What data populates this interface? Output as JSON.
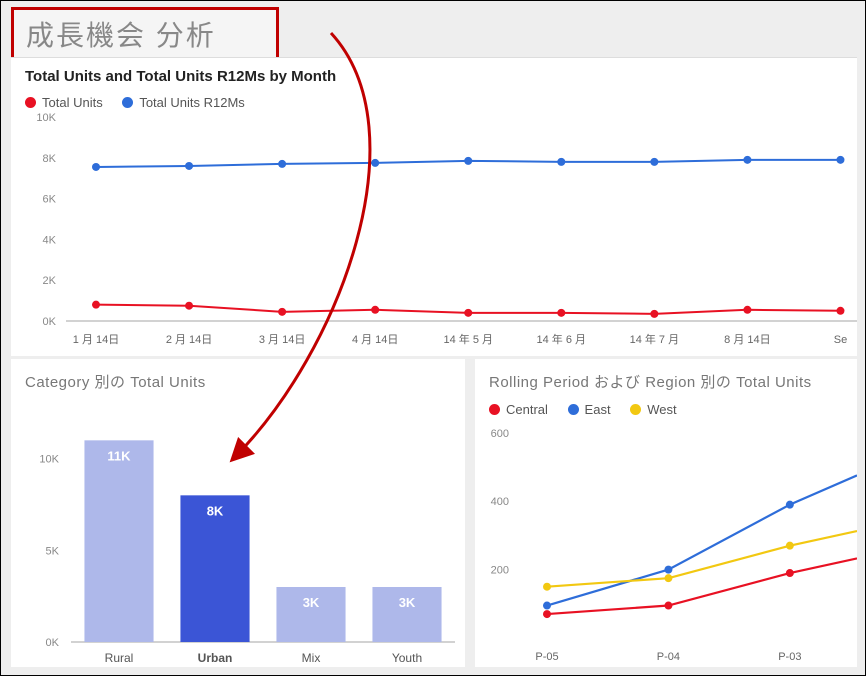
{
  "header": {
    "title": "成長機会 分析"
  },
  "chart_data": [
    {
      "id": "top",
      "type": "line",
      "title": "Total Units and Total Units R12Ms by Month",
      "xlabel": "",
      "ylabel": "",
      "yticks": [
        "0K",
        "2K",
        "4K",
        "6K",
        "8K",
        "10K"
      ],
      "ylim": [
        0,
        10
      ],
      "categories": [
        "1 月 14日",
        "2 月 14日",
        "3 月 14日",
        "4 月 14日",
        "14 年 5 月",
        "14 年 6 月",
        "14 年 7 月",
        "8 月 14日",
        "Se"
      ],
      "series": [
        {
          "name": "Total Units",
          "color": "#e81123",
          "values": [
            0.8,
            0.75,
            0.45,
            0.55,
            0.4,
            0.4,
            0.35,
            0.55,
            0.5
          ]
        },
        {
          "name": "Total Units R12Ms",
          "color": "#2e6dd9",
          "values": [
            7.55,
            7.6,
            7.7,
            7.75,
            7.85,
            7.8,
            7.8,
            7.9,
            7.9
          ]
        }
      ],
      "annotation_highlight_index": 2,
      "annotation_highlight_color": "#c00000"
    },
    {
      "id": "bottom-left",
      "type": "bar",
      "title": "Category 別の Total Units",
      "yticks": [
        "0K",
        "5K",
        "10K"
      ],
      "ylim": [
        0,
        12
      ],
      "categories": [
        "Rural",
        "Urban",
        "Mix",
        "Youth"
      ],
      "values": [
        11,
        8,
        3,
        3
      ],
      "value_labels": [
        "11K",
        "8K",
        "3K",
        "3K"
      ],
      "bar_colors": [
        "#aeb8ea",
        "#3b55d6",
        "#aeb8ea",
        "#aeb8ea"
      ],
      "highlight_index": 1
    },
    {
      "id": "bottom-right",
      "type": "line",
      "title": "Rolling Period および Region 別の Total Units",
      "yticks": [
        "200",
        "400",
        "600"
      ],
      "ylim": [
        0,
        620
      ],
      "categories": [
        "P-05",
        "P-04",
        "P-03"
      ],
      "series": [
        {
          "name": "Central",
          "color": "#e81123",
          "values": [
            70,
            95,
            190
          ]
        },
        {
          "name": "East",
          "color": "#2e6dd9",
          "values": [
            95,
            200,
            390
          ]
        },
        {
          "name": "West",
          "color": "#f2c811",
          "values": [
            150,
            175,
            270
          ]
        }
      ]
    }
  ]
}
